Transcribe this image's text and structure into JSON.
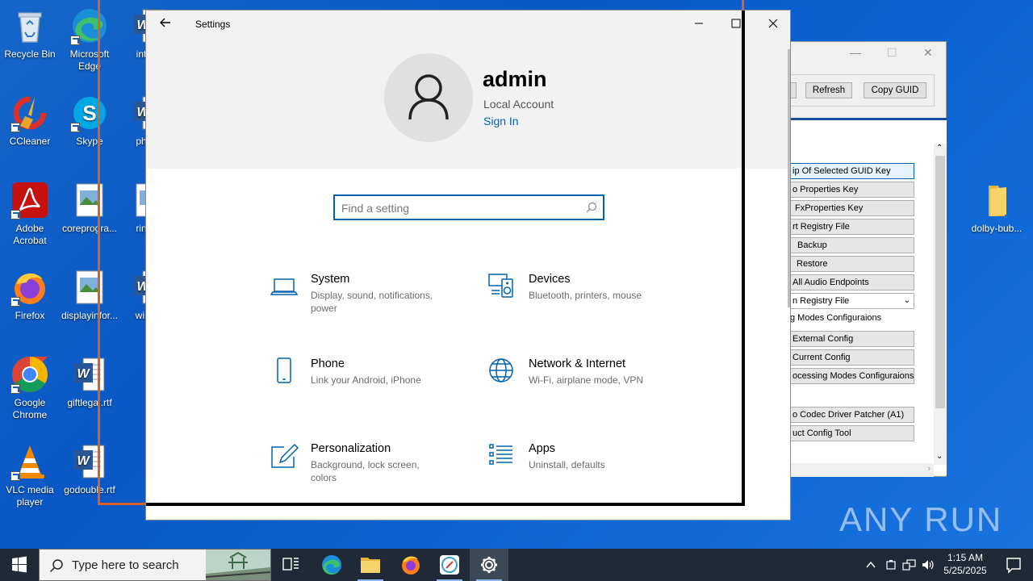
{
  "desktop": {
    "icons": [
      {
        "label": "Recycle Bin"
      },
      {
        "label": "Microsoft Edge"
      },
      {
        "label": "inter..."
      },
      {
        "label": "CCleaner"
      },
      {
        "label": "Skype"
      },
      {
        "label": "phot..."
      },
      {
        "label": "Adobe Acrobat"
      },
      {
        "label": "coreprogra..."
      },
      {
        "label": "ringt..."
      },
      {
        "label": "Firefox"
      },
      {
        "label": "displayinfor..."
      },
      {
        "label": "wine..."
      },
      {
        "label": "Google Chrome"
      },
      {
        "label": "giftlegal.rtf"
      },
      {
        "label": "VLC media player"
      },
      {
        "label": "godouble.rtf"
      },
      {
        "label": "dolby-bub..."
      }
    ]
  },
  "bg_window": {
    "refresh_label": "Refresh",
    "copy_guid_label": "Copy GUID",
    "buttons": [
      "ip Of Selected GUID Key",
      "o Properties Key",
      "FxProperties Key",
      "rt Registry File",
      "Backup",
      "Restore",
      "All Audio Endpoints"
    ],
    "dropdown_value": "n Registry File",
    "section_label": "g Modes Configuraions",
    "buttons2": [
      "External Config",
      "Current Config",
      "ocessing Modes Configuraions"
    ],
    "buttons3": [
      "o Codec Driver Patcher (A1)",
      "uct Config Tool"
    ]
  },
  "settings": {
    "window_title": "Settings",
    "user_name": "admin",
    "account_type": "Local Account",
    "sign_in_label": "Sign In",
    "search_placeholder": "Find a setting",
    "categories": [
      {
        "name": "System",
        "desc": "Display, sound, notifications, power",
        "icon": "laptop-icon"
      },
      {
        "name": "Devices",
        "desc": "Bluetooth, printers, mouse",
        "icon": "devices-icon"
      },
      {
        "name": "Phone",
        "desc": "Link your Android, iPhone",
        "icon": "phone-icon"
      },
      {
        "name": "Network & Internet",
        "desc": "Wi-Fi, airplane mode, VPN",
        "icon": "globe-icon"
      },
      {
        "name": "Personalization",
        "desc": "Background, lock screen, colors",
        "icon": "paint-icon"
      },
      {
        "name": "Apps",
        "desc": "Uninstall, defaults",
        "icon": "apps-list-icon"
      }
    ]
  },
  "taskbar": {
    "search_placeholder": "Type here to search",
    "time": "1:15 AM",
    "date": "5/25/2025"
  },
  "watermark": {
    "text": "ANY RUN"
  },
  "colors": {
    "accent": "#0063b1",
    "desktop": "#0b63d3",
    "taskbar": "#1f2a36"
  }
}
